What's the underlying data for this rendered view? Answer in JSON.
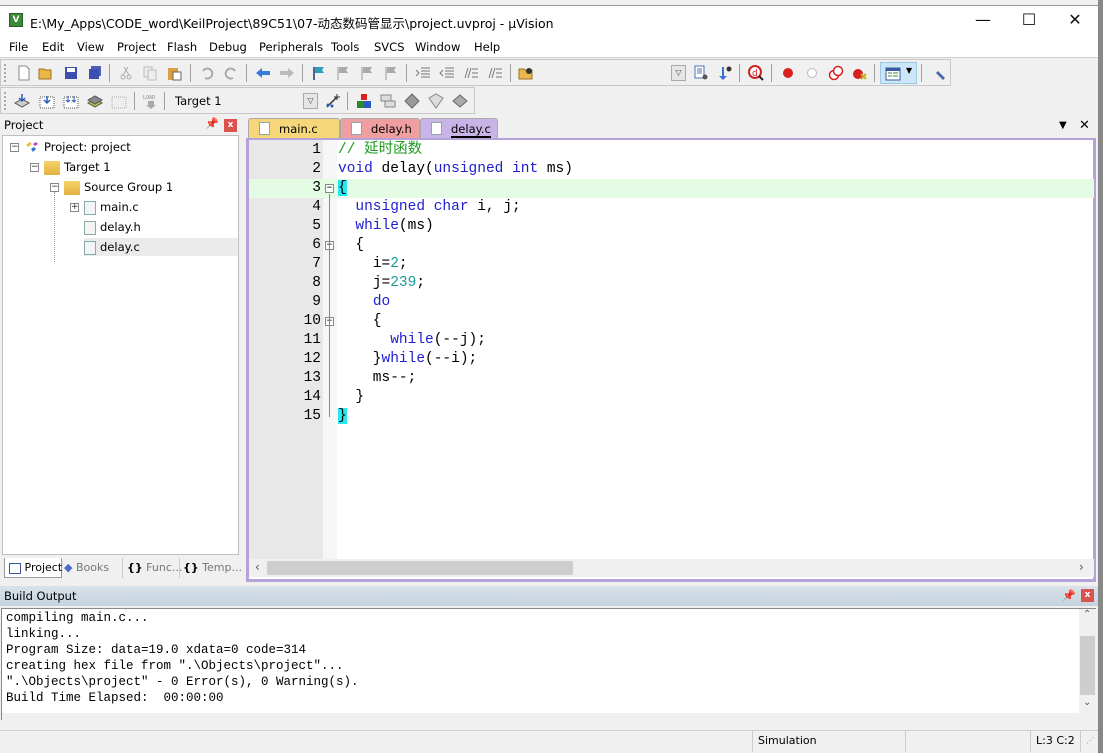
{
  "window": {
    "title": "E:\\My_Apps\\CODE_word\\KeilProject\\89C51\\07-动态数码管显示\\project.uvproj - µVision",
    "app_icon": "uvision-icon",
    "controls": {
      "minimize": "—",
      "maximize": "☐",
      "close": "✕"
    }
  },
  "menu": [
    "File",
    "Edit",
    "View",
    "Project",
    "Flash",
    "Debug",
    "Peripherals",
    "Tools",
    "SVCS",
    "Window",
    "Help"
  ],
  "toolbar1": {
    "icons": [
      "new-file-icon",
      "open-folder-icon",
      "save-icon",
      "save-all-icon",
      "cut-icon",
      "copy-icon",
      "paste-icon",
      "undo-icon",
      "redo-icon",
      "navigate-back-icon",
      "navigate-forward-icon",
      "bookmark-icon",
      "prev-bookmark-icon",
      "next-bookmark-icon",
      "clear-bookmarks-icon",
      "indent-icon",
      "unindent-icon",
      "comment-icon",
      "uncomment-icon",
      "find-in-files-icon"
    ],
    "right_icons": [
      "find-icon",
      "incremental-find-icon",
      "debug-session-icon",
      "insert-breakpoint-icon",
      "enable-breakpoint-icon",
      "disable-all-breakpoints-icon",
      "kill-all-breakpoints-icon",
      "window-layout-icon",
      "configure-icon"
    ]
  },
  "toolbar2": {
    "icons": [
      "translate-icon",
      "build-icon",
      "rebuild-icon",
      "batch-build-icon",
      "stop-build-icon",
      "download-icon"
    ],
    "target": "Target 1",
    "after_icons": [
      "target-options-icon",
      "file-extensions-icon",
      "manage-rte-icon",
      "select-packs-icon",
      "pack-installer-icon"
    ]
  },
  "project_panel": {
    "title": "Project",
    "tree": [
      {
        "label": "Project: project",
        "level": 0,
        "expander": "−",
        "icon": "project-icon"
      },
      {
        "label": "Target 1",
        "level": 1,
        "expander": "−",
        "icon": "target-folder-icon"
      },
      {
        "label": "Source Group 1",
        "level": 2,
        "expander": "−",
        "icon": "folder-icon"
      },
      {
        "label": "main.c",
        "level": 3,
        "expander": "+",
        "icon": "c-file-icon"
      },
      {
        "label": "delay.h",
        "level": 3,
        "expander": "",
        "icon": "h-file-icon"
      },
      {
        "label": "delay.c",
        "level": 3,
        "expander": "",
        "icon": "c-file-icon",
        "selected": true
      }
    ],
    "tabs": [
      "Project",
      "Books",
      "Func...",
      "Temp..."
    ],
    "tab_icons": [
      "project-tab-icon",
      "books-icon",
      "functions-icon",
      "templates-icon"
    ]
  },
  "editor": {
    "tabs": [
      {
        "label": "main.c",
        "color": "#f5d77a"
      },
      {
        "label": "delay.h",
        "color": "#ef9f9f"
      },
      {
        "label": "delay.c",
        "color": "#c8b4e6",
        "active": true
      }
    ],
    "current_line": 3,
    "lines": [
      {
        "n": "1",
        "segs": [
          [
            "cm",
            "// 延时函数"
          ]
        ]
      },
      {
        "n": "2",
        "segs": [
          [
            "kw",
            "void"
          ],
          [
            "",
            " delay("
          ],
          [
            "kw",
            "unsigned int"
          ],
          [
            "",
            " ms)"
          ]
        ]
      },
      {
        "n": "3",
        "segs": [
          [
            "hl",
            "{"
          ]
        ],
        "fold": "−"
      },
      {
        "n": "4",
        "segs": [
          [
            "",
            "  "
          ],
          [
            "kw",
            "unsigned char"
          ],
          [
            "",
            " i, j;"
          ]
        ]
      },
      {
        "n": "5",
        "segs": [
          [
            "",
            "  "
          ],
          [
            "kw",
            "while"
          ],
          [
            "",
            "(ms)"
          ]
        ]
      },
      {
        "n": "6",
        "segs": [
          [
            "",
            "  {"
          ]
        ],
        "fold": "−"
      },
      {
        "n": "7",
        "segs": [
          [
            "",
            "    i="
          ],
          [
            "num",
            "2"
          ],
          [
            "",
            ";"
          ]
        ]
      },
      {
        "n": "8",
        "segs": [
          [
            "",
            "    j="
          ],
          [
            "num",
            "239"
          ],
          [
            "",
            ";"
          ]
        ]
      },
      {
        "n": "9",
        "segs": [
          [
            "",
            "    "
          ],
          [
            "kw",
            "do"
          ]
        ]
      },
      {
        "n": "10",
        "segs": [
          [
            "",
            "    {"
          ]
        ],
        "fold": "−"
      },
      {
        "n": "11",
        "segs": [
          [
            "",
            "      "
          ],
          [
            "kw",
            "while"
          ],
          [
            "",
            "(--j);"
          ]
        ]
      },
      {
        "n": "12",
        "segs": [
          [
            "",
            "    }"
          ],
          [
            "kw",
            "while"
          ],
          [
            "",
            "(--i);"
          ]
        ]
      },
      {
        "n": "13",
        "segs": [
          [
            "",
            "    ms--;"
          ]
        ]
      },
      {
        "n": "14",
        "segs": [
          [
            "",
            "  }"
          ]
        ]
      },
      {
        "n": "15",
        "segs": [
          [
            "hl",
            "}"
          ]
        ]
      }
    ]
  },
  "build_output": {
    "title": "Build Output",
    "lines": [
      "compiling main.c...",
      "linking...",
      "Program Size: data=19.0 xdata=0 code=314",
      "creating hex file from \".\\Objects\\project\"...",
      "\".\\Objects\\project\" - 0 Error(s), 0 Warning(s).",
      "Build Time Elapsed:  00:00:00"
    ]
  },
  "status": {
    "mode": "Simulation",
    "position": "L:3 C:2"
  }
}
